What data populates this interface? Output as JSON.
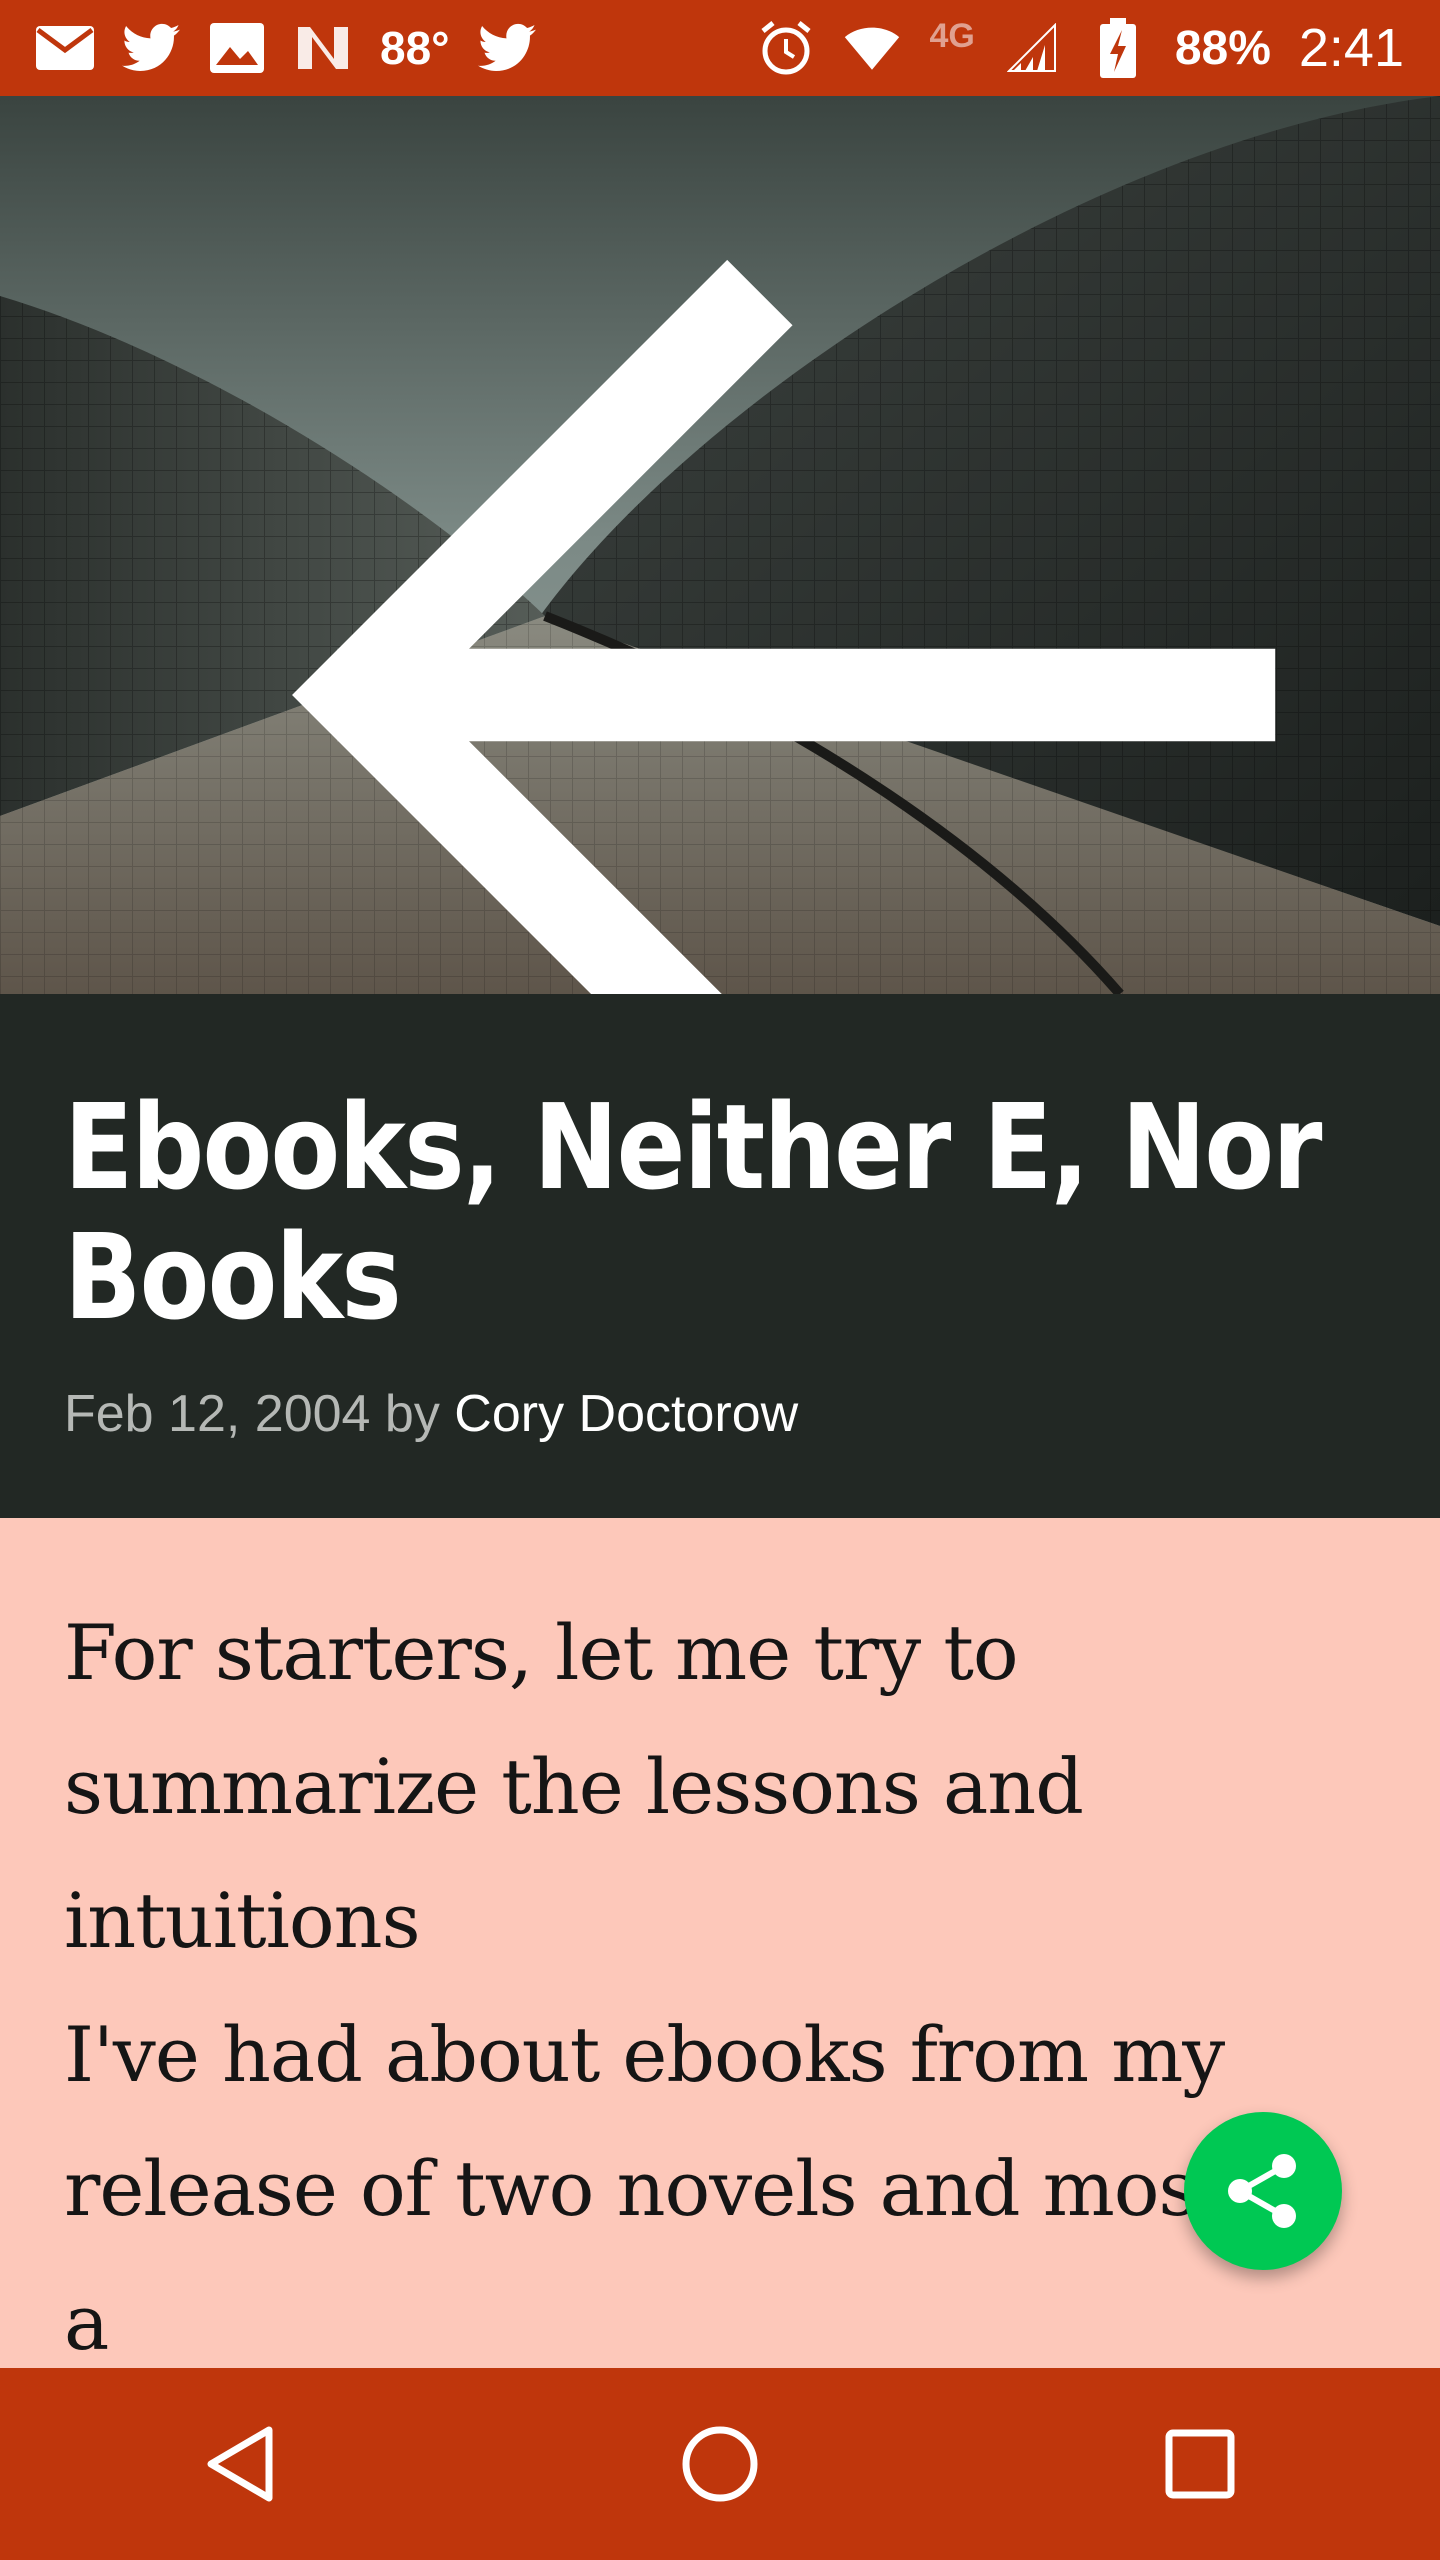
{
  "status_bar": {
    "icons_left": [
      "gmail-icon",
      "twitter-icon",
      "image-icon",
      "news-icon",
      "twitter-icon"
    ],
    "temperature": "88°",
    "icons_right": [
      "alarm-icon",
      "wifi-icon",
      "lte-icon",
      "signal-icon",
      "battery-charging-icon"
    ],
    "network": "4G",
    "battery": "88%",
    "time": "2:41"
  },
  "article": {
    "title": "Ebooks, Neither E, Nor Books",
    "date": "Feb 12, 2004",
    "by": "by",
    "author": "Cory Doctorow",
    "body": "For starters, let me try to\nsummarize the lessons and\nintuitions\nI've had about ebooks from my\nrelease of two novels and most of a\nshort story collection online under"
  },
  "actions": {
    "back": "back-arrow-icon",
    "share": "share-icon"
  },
  "nav": [
    "back",
    "home",
    "recents"
  ],
  "colors": {
    "accent": "#BF360C",
    "title_bg": "#222824",
    "body_bg": "#FDC8BA",
    "fab": "#00C853"
  }
}
